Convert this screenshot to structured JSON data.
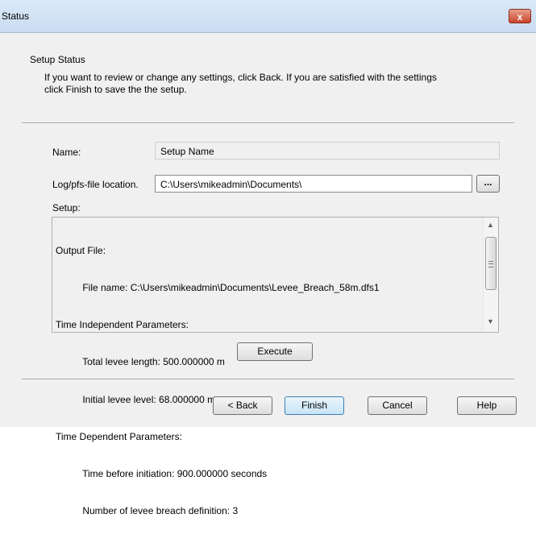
{
  "window": {
    "title": "Status",
    "close_label": "x"
  },
  "header": {
    "title": "Setup Status",
    "description_line1": "If you want to review or change any settings, click Back. If you are satisfied with the settings",
    "description_line2": "click Finish to save the the setup."
  },
  "form": {
    "name_label": "Name:",
    "name_value": "Setup Name",
    "log_label": "Log/pfs-file location.",
    "log_value": "C:\\Users\\mikeadmin\\Documents\\",
    "browse_label": "...",
    "setup_label": "Setup:"
  },
  "setup_text": {
    "lines": [
      "Output File:",
      "          File name: C:\\Users\\mikeadmin\\Documents\\Levee_Breach_58m.dfs1",
      "Time Independent Parameters:",
      "          Total levee length: 500.000000 m",
      "          Initial levee level: 68.000000 m",
      "Time Dependent Parameters:",
      "          Time before initiation: 900.000000 seconds",
      "          Number of levee breach definition: 3"
    ]
  },
  "buttons": {
    "execute": "Execute",
    "back": "< Back",
    "finish": "Finish",
    "cancel": "Cancel",
    "help": "Help"
  }
}
